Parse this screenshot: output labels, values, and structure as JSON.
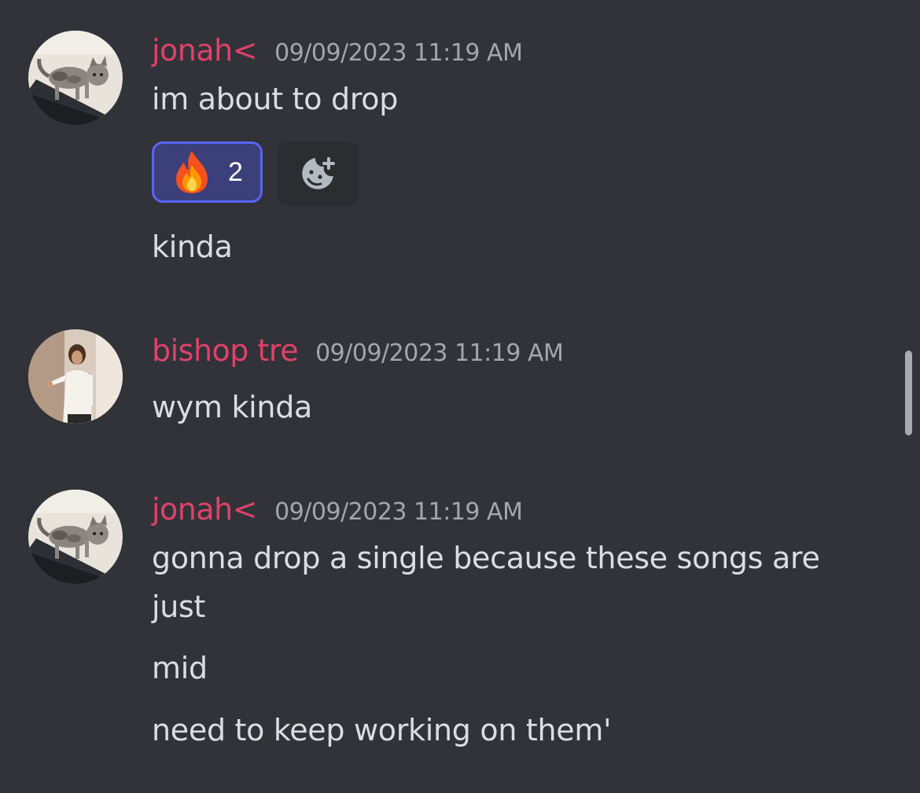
{
  "messages": [
    {
      "author": "jonah<",
      "timestamp": "09/09/2023 11:19 AM",
      "avatar": "cat-on-skateboard-avatar",
      "lines": [
        "im about to drop"
      ],
      "reaction": {
        "emoji": "fire-emoji",
        "count": "2"
      },
      "after_reaction": [
        "kinda"
      ]
    },
    {
      "author": "bishop tre",
      "timestamp": "09/09/2023 11:19 AM",
      "avatar": "person-pointing-avatar",
      "lines": [
        "wym kinda"
      ]
    },
    {
      "author": "jonah<",
      "timestamp": "09/09/2023 11:19 AM",
      "avatar": "cat-on-skateboard-avatar",
      "lines": [
        "gonna drop a single because these songs are",
        "just",
        "mid",
        "need to keep working on them'"
      ]
    }
  ],
  "colors": {
    "background": "#313338",
    "username": "#e0416b",
    "timestamp": "#a3a6ad",
    "message_text": "#dbdee1",
    "reaction_border": "#5865f2",
    "reaction_bg": "#3b3f7a"
  }
}
